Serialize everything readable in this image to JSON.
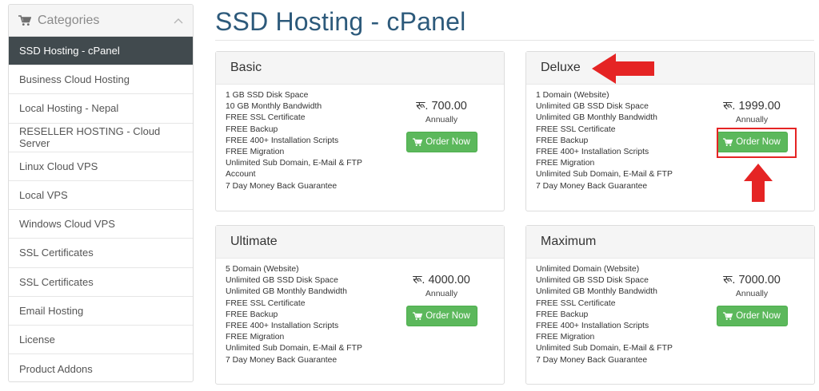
{
  "sidebar": {
    "title": "Categories",
    "items": [
      {
        "label": "SSD Hosting - cPanel",
        "active": true
      },
      {
        "label": "Business Cloud Hosting"
      },
      {
        "label": "Local Hosting - Nepal"
      },
      {
        "label": "RESELLER HOSTING - Cloud Server"
      },
      {
        "label": "Linux Cloud VPS"
      },
      {
        "label": "Local VPS"
      },
      {
        "label": "Windows Cloud VPS"
      },
      {
        "label": "SSL Certificates"
      },
      {
        "label": "SSL Certificates"
      },
      {
        "label": "Email Hosting"
      },
      {
        "label": "License"
      },
      {
        "label": "Product Addons"
      }
    ]
  },
  "page": {
    "title": "SSD Hosting - cPanel"
  },
  "plans": [
    {
      "name": "Basic",
      "price": "रू. 700.00",
      "cycle": "Annually",
      "button": "Order Now",
      "features": [
        "1 GB SSD Disk Space",
        "10 GB Monthly Bandwidth",
        "FREE SSL Certificate",
        "FREE Backup",
        "FREE 400+ Installation Scripts",
        "FREE Migration",
        "Unlimited Sub Domain, E-Mail & FTP",
        "Account",
        "7 Day Money Back Guarantee"
      ]
    },
    {
      "name": "Deluxe",
      "price": "रू. 1999.00",
      "cycle": "Annually",
      "button": "Order Now",
      "features": [
        "1 Domain (Website)",
        "Unlimited GB SSD Disk Space",
        "Unlimited GB Monthly Bandwidth",
        "FREE SSL Certificate",
        "FREE Backup",
        "FREE 400+ Installation Scripts",
        "FREE Migration",
        "Unlimited Sub Domain, E-Mail & FTP",
        "7 Day Money Back Guarantee"
      ]
    },
    {
      "name": "Ultimate",
      "price": "रू. 4000.00",
      "cycle": "Annually",
      "button": "Order Now",
      "features": [
        "5 Domain (Website)",
        "Unlimited GB SSD Disk Space",
        "Unlimited GB Monthly Bandwidth",
        "FREE SSL Certificate",
        "FREE Backup",
        "FREE 400+ Installation Scripts",
        "FREE Migration",
        "Unlimited Sub Domain, E-Mail & FTP",
        "7 Day Money Back Guarantee"
      ]
    },
    {
      "name": "Maximum",
      "price": "रू. 7000.00",
      "cycle": "Annually",
      "button": "Order Now",
      "features": [
        "Unlimited Domain (Website)",
        "Unlimited GB SSD Disk Space",
        "Unlimited GB Monthly Bandwidth",
        "FREE SSL Certificate",
        "FREE Backup",
        "FREE 400+ Installation Scripts",
        "FREE Migration",
        "Unlimited Sub Domain, E-Mail & FTP",
        "7 Day Money Back Guarantee"
      ]
    }
  ],
  "colors": {
    "title": "#2d5a7b",
    "sidebar_active": "#414a4e",
    "button": "#5cb85c",
    "annotation": "#e52424"
  },
  "icons": {
    "sidebar_header": "shopping-cart-icon",
    "sidebar_collapse": "chevron-up-icon",
    "order_button": "shopping-cart-icon"
  }
}
